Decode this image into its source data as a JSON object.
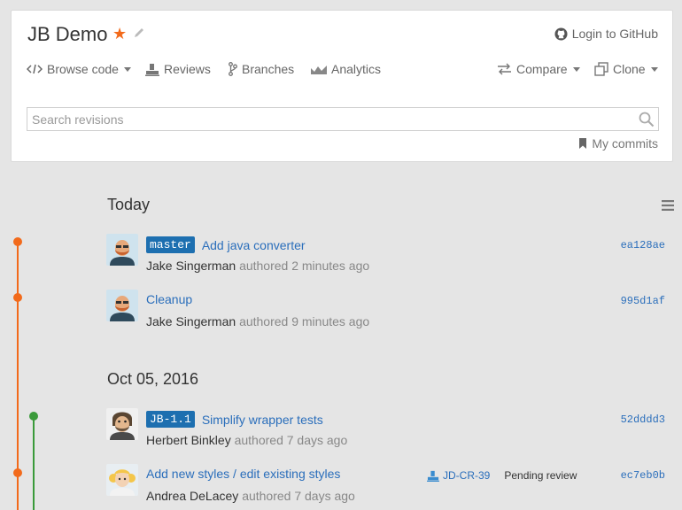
{
  "header": {
    "repo_title": "JB Demo",
    "login_label": "Login to GitHub",
    "nav": {
      "browse_code": "Browse code",
      "reviews": "Reviews",
      "branches": "Branches",
      "analytics": "Analytics",
      "compare": "Compare",
      "clone": "Clone"
    },
    "search_placeholder": "Search revisions",
    "my_commits": "My commits"
  },
  "colors": {
    "accent": "#f26a1b",
    "branch_green": "#3a9a3a",
    "link": "#2a6ebb",
    "tag_bg": "#1d6fb0"
  },
  "groups": [
    {
      "date": "Today",
      "commits": [
        {
          "tag": "master",
          "message": "Add java converter",
          "author": "Jake Singerman",
          "meta": "authored 2 minutes ago",
          "hash": "ea128ae"
        },
        {
          "tag": "",
          "message": "Cleanup",
          "author": "Jake Singerman",
          "meta": "authored 9 minutes ago",
          "hash": "995d1af"
        }
      ]
    },
    {
      "date": "Oct 05, 2016",
      "commits": [
        {
          "tag": "JB-1.1",
          "message": "Simplify wrapper tests",
          "author": "Herbert Binkley",
          "meta": "authored 7 days ago",
          "hash": "52dddd3"
        },
        {
          "tag": "",
          "message": "Add new styles / edit existing styles",
          "author": "Andrea DeLacey",
          "meta": "authored 7 days ago",
          "hash": "ec7eb0b",
          "review_id": "JD-CR-39",
          "review_status": "Pending review"
        }
      ]
    }
  ]
}
